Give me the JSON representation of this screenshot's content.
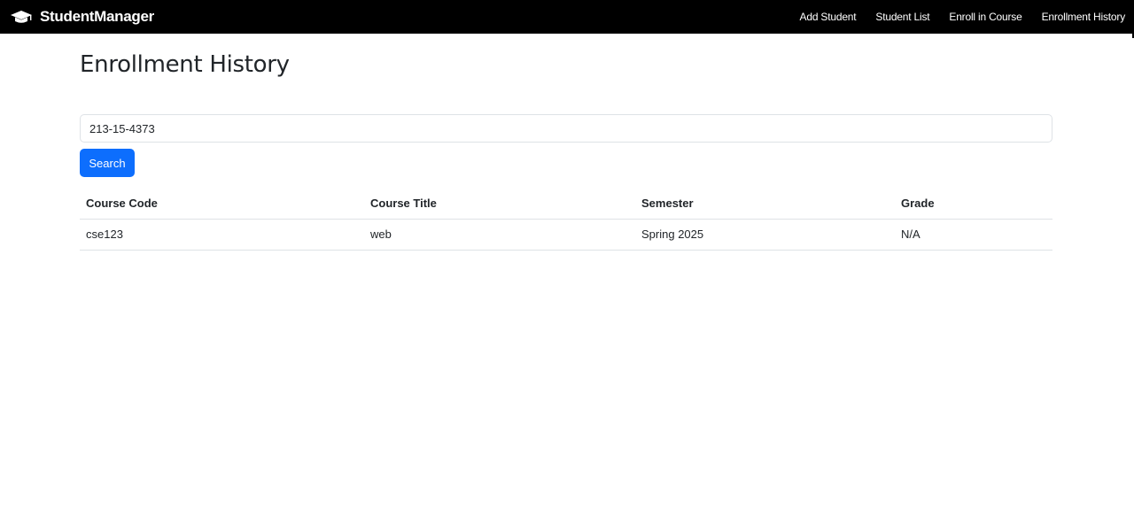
{
  "navbar": {
    "brand": "StudentManager",
    "brand_icon": "graduation-cap-icon",
    "links": [
      "Add Student",
      "Student List",
      "Enroll in Course",
      "Enrollment History"
    ]
  },
  "page": {
    "title": "Enrollment History"
  },
  "search": {
    "value": "213-15-4373",
    "button_label": "Search"
  },
  "table": {
    "headers": [
      "Course Code",
      "Course Title",
      "Semester",
      "Grade"
    ],
    "rows": [
      [
        "cse123",
        "web",
        "Spring 2025",
        "N/A"
      ]
    ]
  },
  "colors": {
    "navbar_bg": "#000000",
    "primary": "#0d6efd",
    "border": "#dee2e6"
  }
}
